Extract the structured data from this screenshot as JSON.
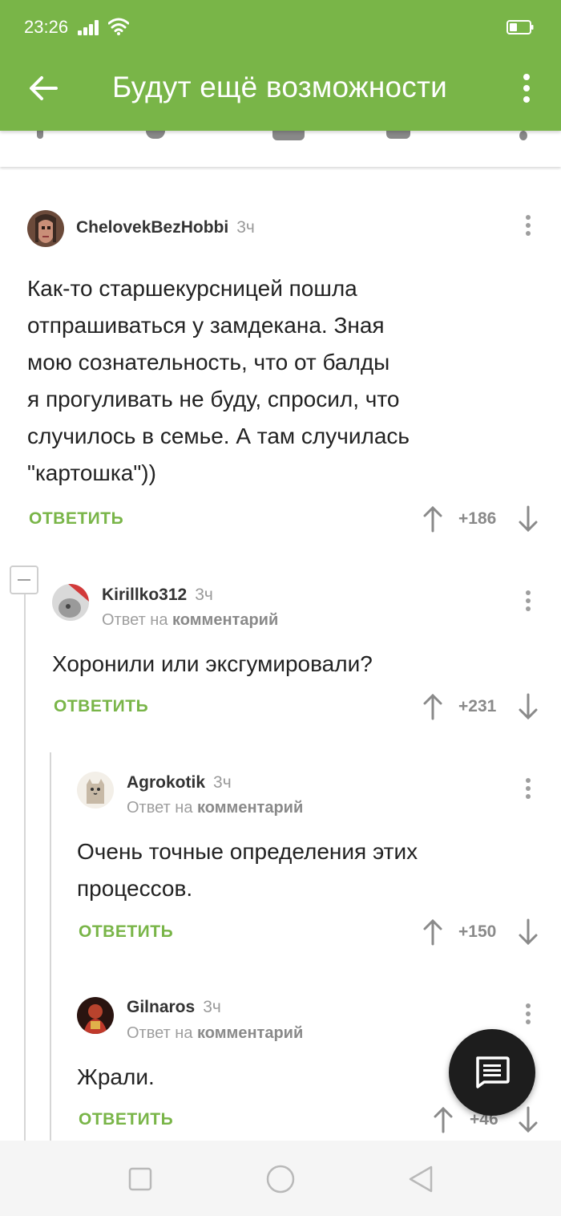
{
  "status": {
    "time": "23:26"
  },
  "header": {
    "title": "Будут ещё возможности"
  },
  "comments": [
    {
      "author": "ChelovekBezHobbi",
      "time_ago": "3ч",
      "text_lines": [
        "Как-то старшекурсницей пошла",
        "отпрашиваться у замдекана. Зная",
        "мою сознательность, что от балды",
        "я прогуливать не буду, спросил, что",
        "случилось в семье. А там случилась",
        "\"картошка\"))"
      ],
      "reply_label": "ОТВЕТИТЬ",
      "score": "+186"
    },
    {
      "author": "Kirillko312",
      "time_ago": "3ч",
      "reply_to_prefix": "Ответ на",
      "reply_to_target": "комментарий",
      "text_lines": [
        "Хоронили или эксгумировали?"
      ],
      "reply_label": "ОТВЕТИТЬ",
      "score": "+231"
    },
    {
      "author": "Agrokotik",
      "time_ago": "3ч",
      "reply_to_prefix": "Ответ на",
      "reply_to_target": "комментарий",
      "text_lines": [
        "Очень точные определения этих",
        "процессов."
      ],
      "reply_label": "ОТВЕТИТЬ",
      "score": "+150"
    },
    {
      "author": "Gilnaros",
      "time_ago": "3ч",
      "reply_to_prefix": "Ответ на",
      "reply_to_target": "комментарий",
      "text_lines": [
        "Жрали."
      ],
      "reply_label": "ОТВЕТИТЬ",
      "score": "+46"
    }
  ],
  "colors": {
    "accent": "#79b548",
    "fab": "#1d1d1d"
  },
  "icons": [
    "back-arrow-icon",
    "overflow-menu-icon",
    "signal-icon",
    "wifi-icon",
    "battery-icon",
    "upvote-icon",
    "downvote-icon",
    "comment-compose-icon",
    "nav-square-icon",
    "nav-circle-icon",
    "nav-triangle-icon"
  ]
}
